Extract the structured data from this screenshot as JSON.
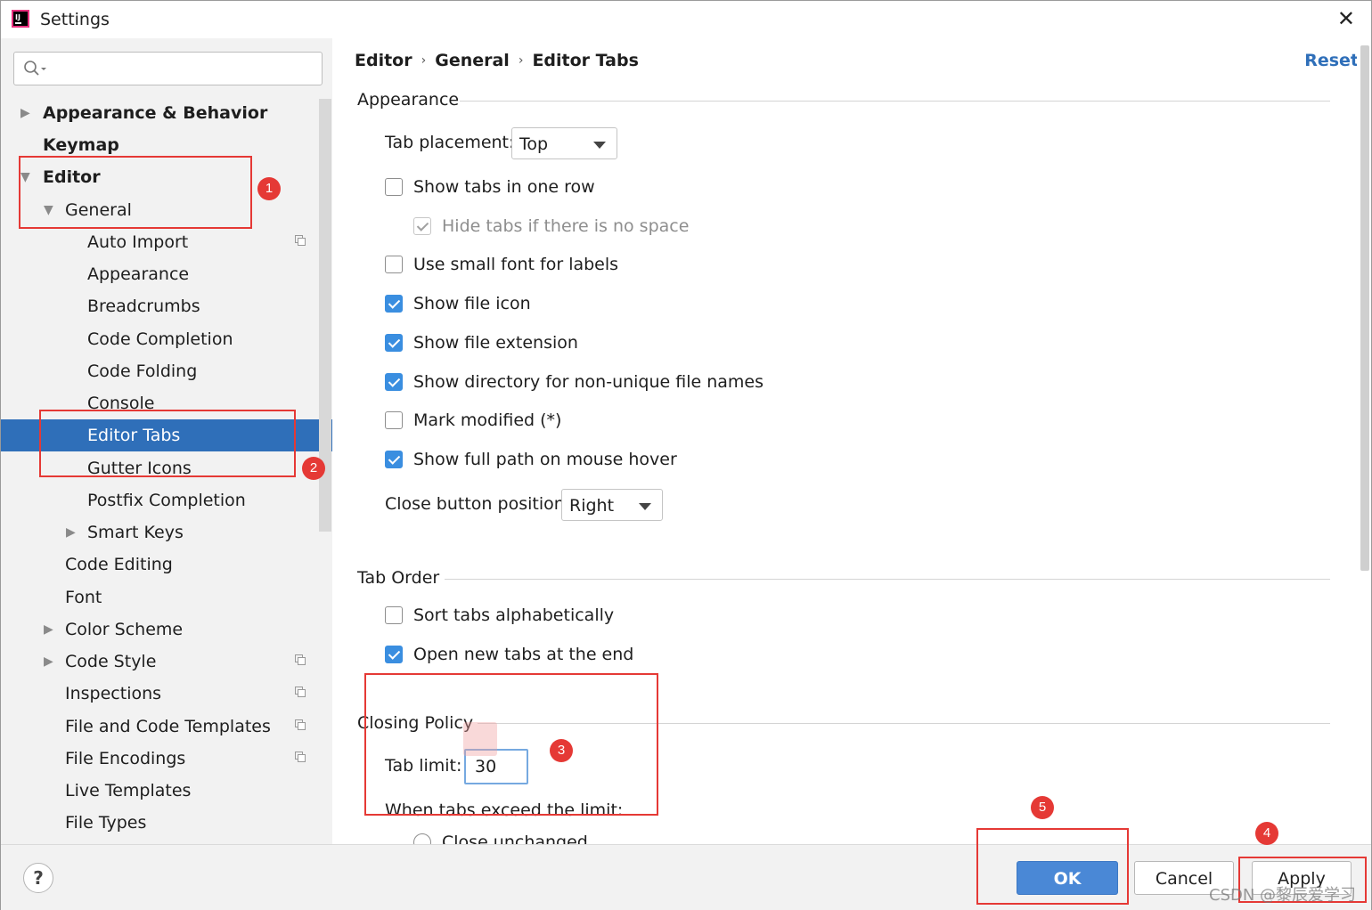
{
  "window": {
    "title": "Settings"
  },
  "search": {
    "placeholder": ""
  },
  "tree": {
    "items": [
      {
        "label": "Appearance & Behavior",
        "bold": true,
        "expander": "collapsed"
      },
      {
        "label": "Keymap",
        "bold": true
      },
      {
        "label": "Editor",
        "bold": true,
        "expander": "expanded"
      },
      {
        "label": "General",
        "expander": "expanded"
      },
      {
        "label": "Auto Import",
        "project_icon": true
      },
      {
        "label": "Appearance"
      },
      {
        "label": "Breadcrumbs"
      },
      {
        "label": "Code Completion"
      },
      {
        "label": "Code Folding"
      },
      {
        "label": "Console"
      },
      {
        "label": "Editor Tabs",
        "selected": true
      },
      {
        "label": "Gutter Icons"
      },
      {
        "label": "Postfix Completion"
      },
      {
        "label": "Smart Keys",
        "expander": "collapsed"
      },
      {
        "label": "Code Editing"
      },
      {
        "label": "Font"
      },
      {
        "label": "Color Scheme",
        "expander": "collapsed"
      },
      {
        "label": "Code Style",
        "expander": "collapsed",
        "project_icon": true
      },
      {
        "label": "Inspections",
        "project_icon": true
      },
      {
        "label": "File and Code Templates",
        "project_icon": true
      },
      {
        "label": "File Encodings",
        "project_icon": true
      },
      {
        "label": "Live Templates"
      },
      {
        "label": "File Types"
      }
    ]
  },
  "breadcrumb": {
    "items": [
      "Editor",
      "General",
      "Editor Tabs"
    ],
    "reset_label": "Reset"
  },
  "appearance": {
    "heading": "Appearance",
    "tab_placement_label": "Tab placement:",
    "tab_placement_value": "Top",
    "show_tabs_one_row": {
      "label": "Show tabs in one row",
      "checked": false
    },
    "hide_tabs_no_space": {
      "label": "Hide tabs if there is no space",
      "checked": true,
      "disabled": true
    },
    "use_small_font": {
      "label": "Use small font for labels",
      "checked": false
    },
    "show_file_icon": {
      "label": "Show file icon",
      "checked": true
    },
    "show_file_extension": {
      "label": "Show file extension",
      "checked": true
    },
    "show_directory": {
      "label": "Show directory for non-unique file names",
      "checked": true
    },
    "mark_modified": {
      "label": "Mark modified (*)",
      "checked": false
    },
    "show_full_path": {
      "label": "Show full path on mouse hover",
      "checked": true
    },
    "close_button_position_label": "Close button position:",
    "close_button_position_value": "Right"
  },
  "tab_order": {
    "heading": "Tab Order",
    "sort_alphabetically": {
      "label": "Sort tabs alphabetically",
      "checked": false
    },
    "open_new_tabs_end": {
      "label": "Open new tabs at the end",
      "checked": true
    }
  },
  "closing_policy": {
    "heading": "Closing Policy",
    "tab_limit_label": "Tab limit:",
    "tab_limit_value": "30",
    "exceed_label": "When tabs exceed the limit:",
    "close_unchanged_label": "Close unchanged"
  },
  "footer": {
    "help_label": "?",
    "ok_label": "OK",
    "cancel_label": "Cancel",
    "apply_label": "Apply"
  },
  "annotations": {
    "badges": [
      "1",
      "2",
      "3",
      "4",
      "5"
    ]
  },
  "watermark": "CSDN @黎辰爱学习",
  "colors": {
    "selection": "#2f6fb9",
    "accent": "#3a8ee0",
    "annotation": "#e53935",
    "ok_button": "#4a88d6"
  }
}
